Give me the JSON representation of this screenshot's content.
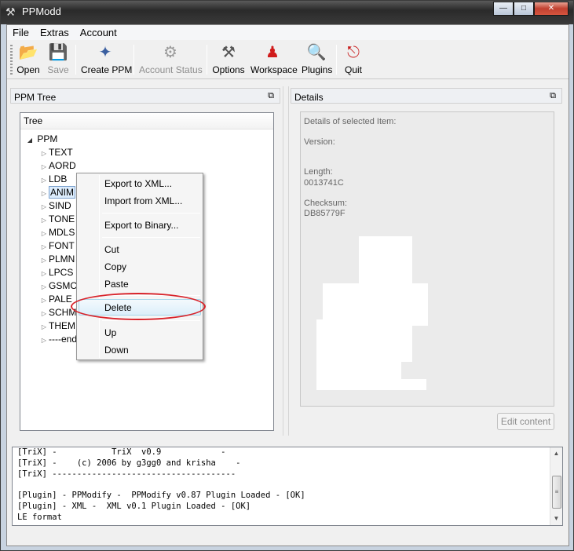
{
  "window": {
    "title": "PPModd",
    "app_icon": "tools-icon",
    "controls": {
      "minimize": "minimize-icon",
      "maximize": "maximize-icon",
      "close": "close-icon"
    }
  },
  "menubar": {
    "items": [
      "File",
      "Extras",
      "Account"
    ]
  },
  "toolbar": {
    "buttons": [
      {
        "label": "Open",
        "icon": "folder-open-icon",
        "enabled": true
      },
      {
        "label": "Save",
        "icon": "save-disk-icon",
        "enabled": false
      },
      {
        "label": "Create PPM",
        "icon": "create-ppm-icon",
        "enabled": true
      },
      {
        "label": "Account Status",
        "icon": "account-status-icon",
        "enabled": false
      },
      {
        "label": "Options",
        "icon": "wrench-screwdriver-icon",
        "enabled": true
      },
      {
        "label": "Workspace",
        "icon": "workspace-person-icon",
        "enabled": true
      },
      {
        "label": "Plugins",
        "icon": "magnifier-icon",
        "enabled": true
      },
      {
        "label": "Quit",
        "icon": "exit-door-icon",
        "enabled": true
      }
    ]
  },
  "tree_pane": {
    "title": "PPM Tree",
    "column_header": "Tree",
    "root": "PPM",
    "nodes": [
      "TEXT",
      "AORD",
      "LDB",
      "ANIM",
      "SIND",
      "TONE",
      "MDLS",
      "FONT",
      "PLMN",
      "LPCS",
      "GSMC",
      "PALE",
      "SCHM",
      "THEM",
      "----end"
    ],
    "selected_index": 3
  },
  "details_pane": {
    "title": "Details",
    "heading": "Details of selected Item:",
    "version_label": "Version:",
    "version_value": "",
    "length_label": "Length:",
    "length_value": "0013741C",
    "checksum_label": "Checksum:",
    "checksum_value": "DB85779F",
    "edit_button": "Edit content"
  },
  "context_menu": {
    "groups": [
      [
        "Export to XML...",
        "Import from XML..."
      ],
      [
        "Export to Binary..."
      ],
      [
        "Cut",
        "Copy",
        "Paste"
      ],
      [
        "Delete"
      ],
      [
        "Up",
        "Down"
      ]
    ],
    "highlighted": "Delete",
    "annotation_color": "#d8232a"
  },
  "log": {
    "lines": [
      "[TriX] -           TriX  v0.9            -",
      "[TriX] -    (c) 2006 by g3gg0 and krisha    -",
      "[TriX] -------------------------------------",
      "",
      "[Plugin] - PPModify -  PPModify v0.87 Plugin Loaded - [OK]",
      "[Plugin] - XML -  XML v0.1 Plugin Loaded - [OK]",
      "LE format"
    ]
  }
}
